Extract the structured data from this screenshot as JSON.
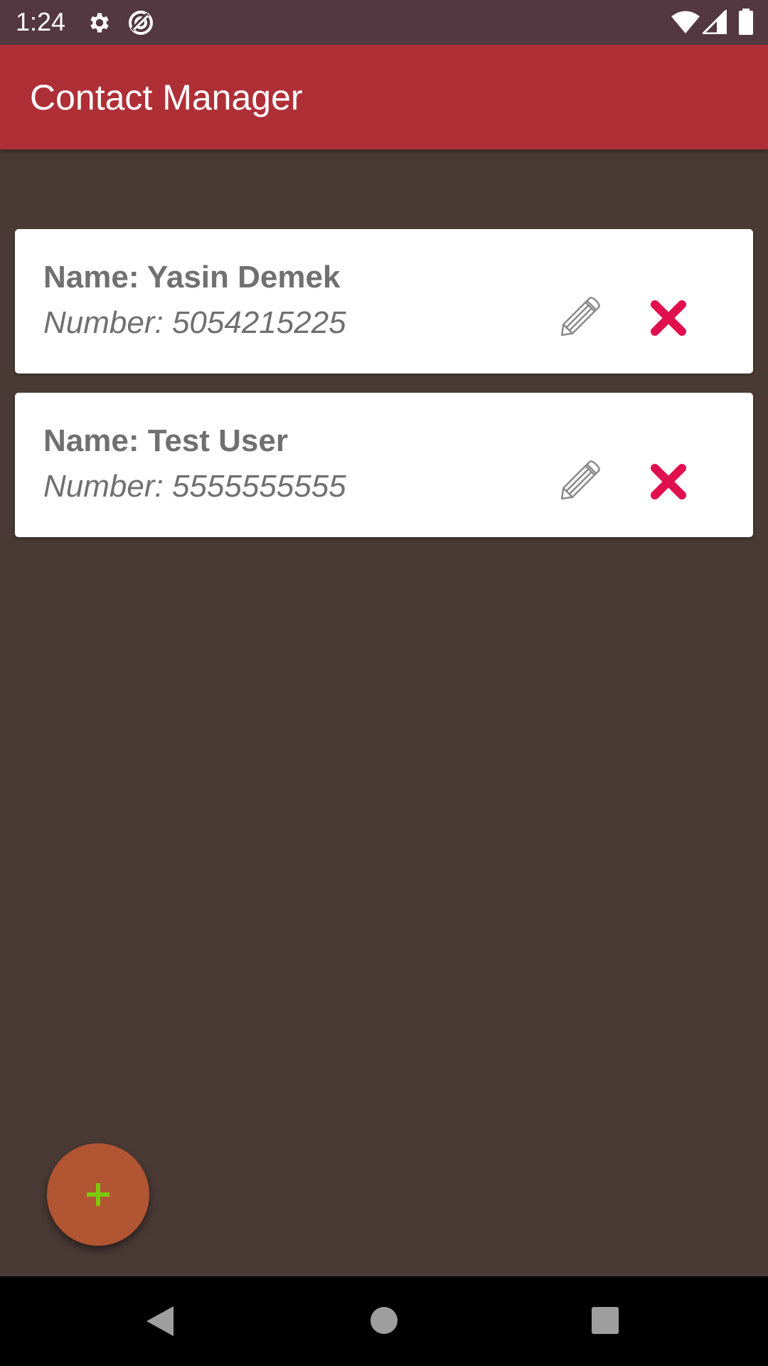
{
  "status_bar": {
    "time": "1:24",
    "icons": [
      "settings-icon",
      "data-saver-icon",
      "wifi-icon",
      "signal-icon",
      "battery-icon"
    ]
  },
  "app_bar": {
    "title": "Contact Manager",
    "color": "#af2f37"
  },
  "contacts": [
    {
      "name_label": "Name: Yasin Demek",
      "number_label": "Number: 5054215225"
    },
    {
      "name_label": "Name: Test User",
      "number_label": "Number: 5555555555"
    }
  ],
  "card_actions": {
    "edit_icon": "pencil-icon",
    "delete_icon": "close-icon",
    "delete_color": "#e0104f"
  },
  "fab": {
    "icon": "plus-icon",
    "color": "#b25533",
    "icon_color": "#7cc80c"
  },
  "nav_bar": {
    "buttons": [
      "back-icon",
      "home-icon",
      "recents-icon"
    ]
  },
  "colors": {
    "background": "#4a3a35",
    "status_bar": "#533841",
    "card": "#ffffff",
    "text": "#707070"
  }
}
